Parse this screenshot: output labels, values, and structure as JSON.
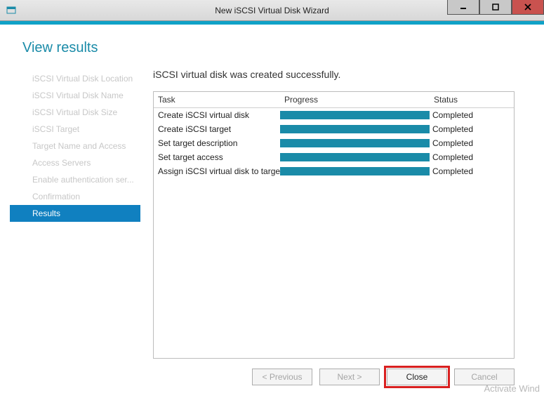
{
  "window": {
    "title": "New iSCSI Virtual Disk Wizard"
  },
  "heading": "View results",
  "sidebar": {
    "items": [
      {
        "label": "iSCSI Virtual Disk Location",
        "active": false
      },
      {
        "label": "iSCSI Virtual Disk Name",
        "active": false
      },
      {
        "label": "iSCSI Virtual Disk Size",
        "active": false
      },
      {
        "label": "iSCSI Target",
        "active": false
      },
      {
        "label": "Target Name and Access",
        "active": false
      },
      {
        "label": "Access Servers",
        "active": false
      },
      {
        "label": "Enable authentication ser...",
        "active": false
      },
      {
        "label": "Confirmation",
        "active": false
      },
      {
        "label": "Results",
        "active": true
      }
    ]
  },
  "main": {
    "message": "iSCSI virtual disk was created successfully.",
    "columns": {
      "task": "Task",
      "progress": "Progress",
      "status": "Status"
    },
    "rows": [
      {
        "task": "Create iSCSI virtual disk",
        "progress": 100,
        "status": "Completed"
      },
      {
        "task": "Create iSCSI target",
        "progress": 100,
        "status": "Completed"
      },
      {
        "task": "Set target description",
        "progress": 100,
        "status": "Completed"
      },
      {
        "task": "Set target access",
        "progress": 100,
        "status": "Completed"
      },
      {
        "task": "Assign iSCSI virtual disk to target",
        "progress": 100,
        "status": "Completed"
      }
    ]
  },
  "buttons": {
    "previous": "< Previous",
    "next": "Next >",
    "close": "Close",
    "cancel": "Cancel"
  },
  "watermark": "Activate Wind"
}
